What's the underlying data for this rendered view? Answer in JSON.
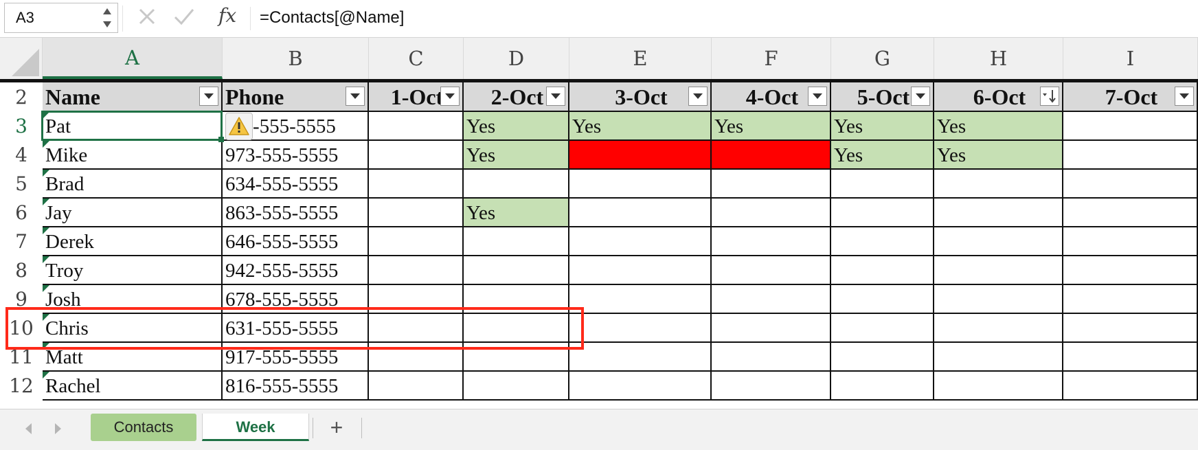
{
  "name_box": "A3",
  "formula": "=Contacts[@Name]",
  "fx_label": "fx",
  "columns": [
    "A",
    "B",
    "C",
    "D",
    "E",
    "F",
    "G",
    "H",
    "I"
  ],
  "rows": [
    "2",
    "3",
    "4",
    "5",
    "6",
    "7",
    "8",
    "9",
    "10",
    "11",
    "12"
  ],
  "table_headers": [
    "Name",
    "Phone",
    "1-Oct",
    "2-Oct",
    "3-Oct",
    "4-Oct",
    "5-Oct",
    "6-Oct",
    "7-Oct"
  ],
  "table_rows": [
    {
      "name": "Pat",
      "phone": "-555-5555",
      "days": [
        "",
        "Yes",
        "Yes",
        "Yes",
        "Yes",
        "Yes",
        ""
      ]
    },
    {
      "name": "Mike",
      "phone": "973-555-5555",
      "days": [
        "",
        "Yes",
        "",
        "",
        "Yes",
        "Yes",
        ""
      ]
    },
    {
      "name": "Brad",
      "phone": "634-555-5555",
      "days": [
        "",
        "",
        "",
        "",
        "",
        "",
        ""
      ]
    },
    {
      "name": "Jay",
      "phone": "863-555-5555",
      "days": [
        "",
        "Yes",
        "",
        "",
        "",
        "",
        ""
      ]
    },
    {
      "name": "Derek",
      "phone": "646-555-5555",
      "days": [
        "",
        "",
        "",
        "",
        "",
        "",
        ""
      ]
    },
    {
      "name": "Troy",
      "phone": "942-555-5555",
      "days": [
        "",
        "",
        "",
        "",
        "",
        "",
        ""
      ]
    },
    {
      "name": "Josh",
      "phone": "678-555-5555",
      "days": [
        "",
        "",
        "",
        "",
        "",
        "",
        ""
      ]
    },
    {
      "name": "Chris",
      "phone": "631-555-5555",
      "days": [
        "",
        "",
        "",
        "",
        "",
        "",
        ""
      ]
    },
    {
      "name": "Matt",
      "phone": "917-555-5555",
      "days": [
        "",
        "",
        "",
        "",
        "",
        "",
        ""
      ]
    },
    {
      "name": "Rachel",
      "phone": "816-555-5555",
      "days": [
        "",
        "",
        "",
        "",
        "",
        "",
        ""
      ]
    }
  ],
  "red_cells": [
    [
      1,
      2
    ],
    [
      1,
      3
    ]
  ],
  "sorted_column_index": 7,
  "sheet_tabs": [
    "Contacts",
    "Week"
  ],
  "active_tab": "Week",
  "add_sheet_label": "+",
  "colors": {
    "accent": "#1e7145",
    "yes_fill": "#c6e0b4",
    "alert_fill": "#ff0000",
    "highlight_box": "#ff2a1a",
    "contacts_tab": "#a9d08e"
  },
  "icons": {
    "cancel": "close-icon",
    "enter": "check-icon",
    "warning": "warning-icon",
    "filter": "filter-dropdown-icon",
    "sorted": "sort-descending-icon"
  }
}
